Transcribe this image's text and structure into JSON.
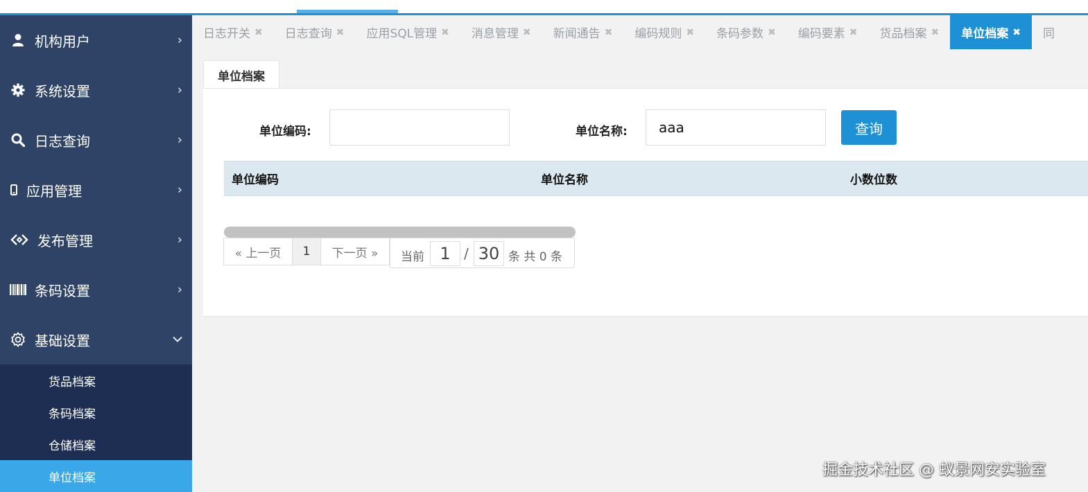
{
  "sidebar": {
    "menus": [
      {
        "label": "机构用户",
        "icon": "user-icon"
      },
      {
        "label": "系统设置",
        "icon": "gear-icon"
      },
      {
        "label": "日志查询",
        "icon": "search-icon"
      },
      {
        "label": "应用管理",
        "icon": "mobile-icon"
      },
      {
        "label": "发布管理",
        "icon": "code-icon"
      },
      {
        "label": "条码设置",
        "icon": "barcode-icon"
      },
      {
        "label": "基础设置",
        "icon": "settings-icon"
      }
    ],
    "chevron_right": "›",
    "chevron_down": "⌄",
    "submenu": [
      {
        "label": "货品档案"
      },
      {
        "label": "条码档案"
      },
      {
        "label": "仓储档案"
      },
      {
        "label": "单位档案"
      }
    ]
  },
  "tabs": [
    {
      "label": "日志开关"
    },
    {
      "label": "日志查询"
    },
    {
      "label": "应用SQL管理"
    },
    {
      "label": "消息管理"
    },
    {
      "label": "新闻通告"
    },
    {
      "label": "编码规则"
    },
    {
      "label": "条码参数"
    },
    {
      "label": "编码要素"
    },
    {
      "label": "货品档案"
    },
    {
      "label": "单位档案"
    },
    {
      "label": "同"
    }
  ],
  "tab_close": "✖",
  "panel": {
    "tab_label": "单位档案",
    "search": {
      "code_label": "单位编码:",
      "code_value": "",
      "name_label": "单位名称:",
      "name_value": "aaa",
      "query_button": "查询"
    },
    "table": {
      "columns": [
        "单位编码",
        "单位名称",
        "小数位数"
      ]
    },
    "pager": {
      "prev": "« 上一页",
      "page": "1",
      "next": "下一页 »",
      "current_label": "当前",
      "current_page": "1",
      "slash": "/",
      "total_pages": "30",
      "tail": "条 共 0 条"
    }
  },
  "watermark": "掘金技术社区 @ 蚁景网安实验室",
  "colors": {
    "sidebar_bg": "#2f4366",
    "submenu_bg": "#1d2e52",
    "active_sub": "#3aa8e8",
    "accent": "#1e90d6",
    "table_header": "#dce8f0"
  }
}
